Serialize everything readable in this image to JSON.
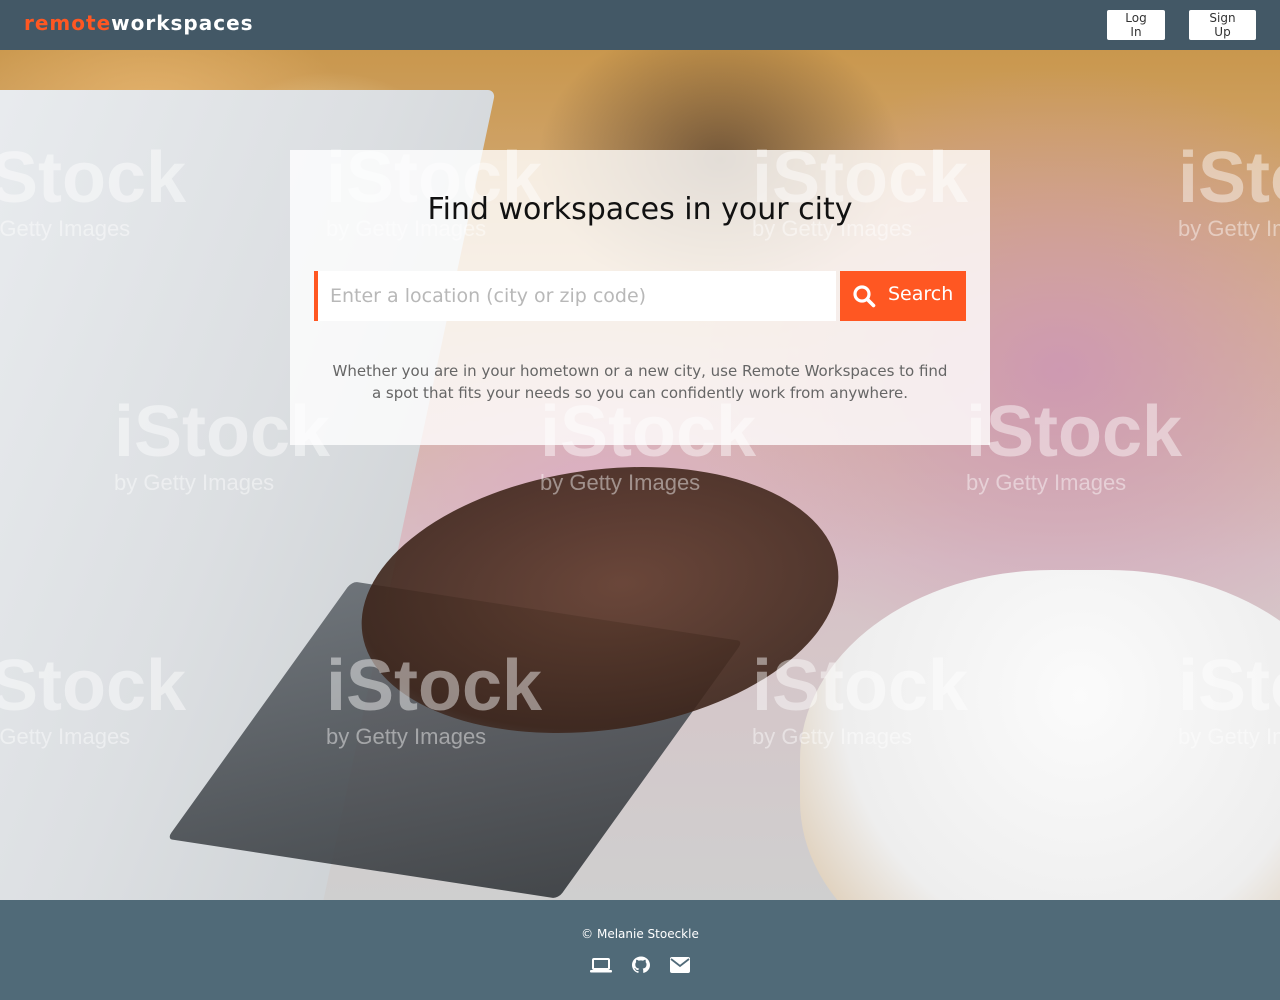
{
  "header": {
    "brand_part1": "remote",
    "brand_part2": "workspaces",
    "login_label": "Log In",
    "signup_label": "Sign Up"
  },
  "hero": {
    "title": "Find workspaces in your city",
    "search_placeholder": "Enter a location (city or zip code)",
    "search_value": "",
    "search_button_label": "Search",
    "description": "Whether you are in your hometown or a new city, use Remote Workspaces to find a spot that fits your needs so you can confidently work from anywhere."
  },
  "watermark": {
    "logo": "iStock",
    "tagline": "by Getty Images"
  },
  "footer": {
    "copyright": "© Melanie Stoeckle",
    "icons": [
      "laptop-icon",
      "github-icon",
      "envelope-icon"
    ]
  },
  "colors": {
    "accent": "#ff5722",
    "header_bg": "#435866",
    "footer_bg": "#506a78"
  }
}
